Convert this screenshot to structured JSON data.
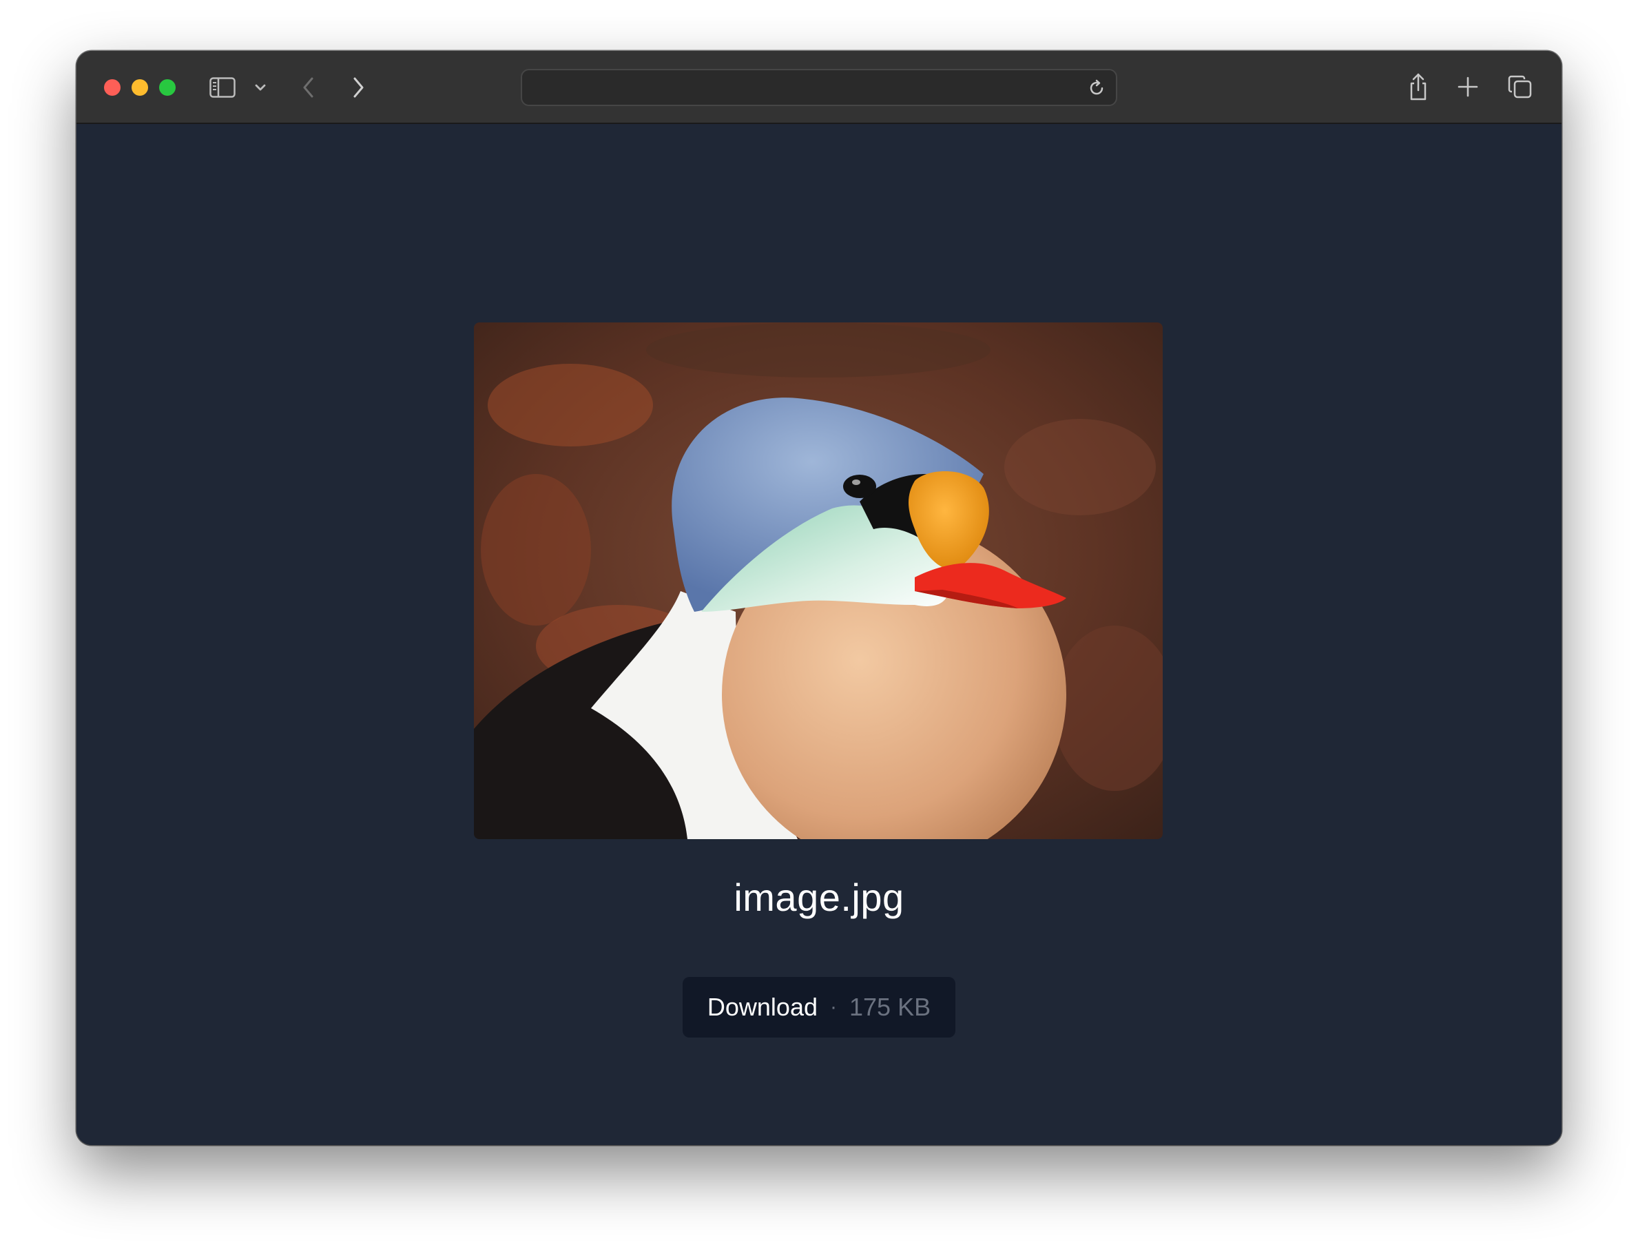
{
  "browser": {
    "address_value": "",
    "address_placeholder": "",
    "icons": {
      "sidebar": "sidebar-icon",
      "chevron": "chevron-down-icon",
      "back": "back-arrow-icon",
      "forward": "forward-arrow-icon",
      "reload": "reload-icon",
      "share": "share-icon",
      "new_tab": "plus-icon",
      "tabs": "tab-overview-icon"
    }
  },
  "page": {
    "filename": "image.jpg",
    "download_label": "Download",
    "separator": "·",
    "file_size": "175 KB",
    "image_subject": "king eider duck"
  },
  "colors": {
    "page_background": "#1f2736",
    "toolbar_background": "#333333",
    "button_background": "#111827",
    "muted_text": "#6b7280"
  }
}
